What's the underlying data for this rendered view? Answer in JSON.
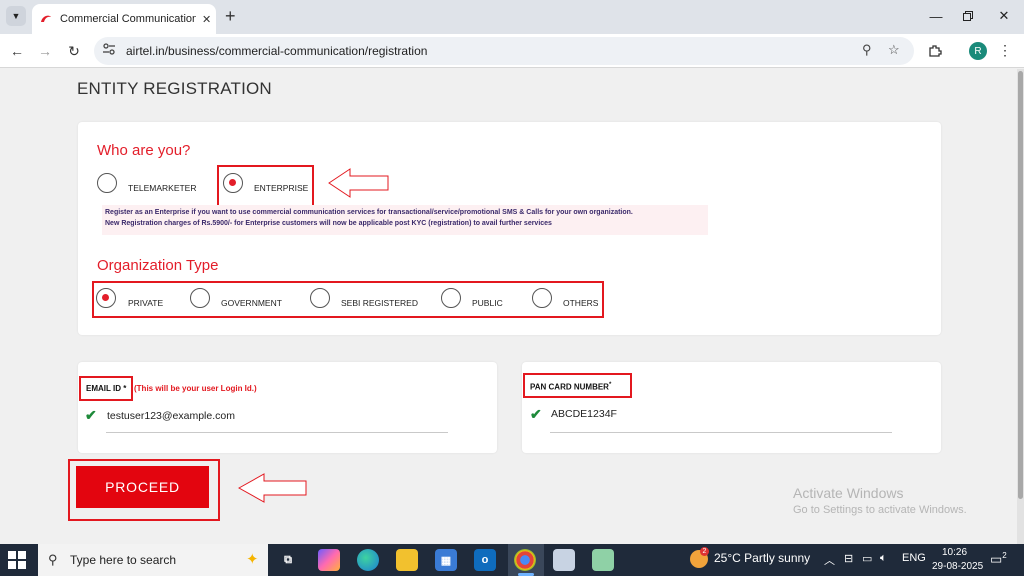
{
  "browser": {
    "tab_title": "Commercial Communication Pl",
    "url": "airtel.in/business/commercial-communication/registration",
    "profile_initial": "R"
  },
  "page": {
    "title": "ENTITY REGISTRATION",
    "who_heading": "Who are you?",
    "who_options": [
      {
        "label": "TELEMARKETER",
        "selected": false
      },
      {
        "label": "ENTERPRISE",
        "selected": true
      }
    ],
    "info_lines": [
      "Register as an Enterprise if you want to use commercial communication services for transactional/service/promotional SMS & Calls for your own organization.",
      "New Registration charges of Rs.5900/- for Enterprise customers will now be applicable post KYC (registration) to avail further services"
    ],
    "org_heading": "Organization Type",
    "org_options": [
      {
        "label": "PRIVATE",
        "selected": true
      },
      {
        "label": "GOVERNMENT",
        "selected": false
      },
      {
        "label": "SEBI REGISTERED",
        "selected": false
      },
      {
        "label": "PUBLIC",
        "selected": false
      },
      {
        "label": "OTHERS",
        "selected": false
      }
    ],
    "email_label": "EMAIL ID *",
    "email_note": "(This will be your user Login Id.)",
    "email_value": "testuser123@example.com",
    "pan_label": "PAN CARD NUMBER",
    "pan_asterisk": "*",
    "pan_value": "ABCDE1234F",
    "proceed_label": "PROCEED",
    "watermark_title": "Activate Windows",
    "watermark_sub": "Go to Settings to activate Windows."
  },
  "taskbar": {
    "search_placeholder": "Type here to search",
    "weather_temp": "25°C",
    "weather_desc": "Partly sunny",
    "weather_badge": "2",
    "language": "ENG",
    "time": "10:26",
    "date": "29-08-2025",
    "notification_count": "2"
  },
  "colors": {
    "accent_red": "#e31e2a",
    "check_green": "#1e8a3a"
  }
}
